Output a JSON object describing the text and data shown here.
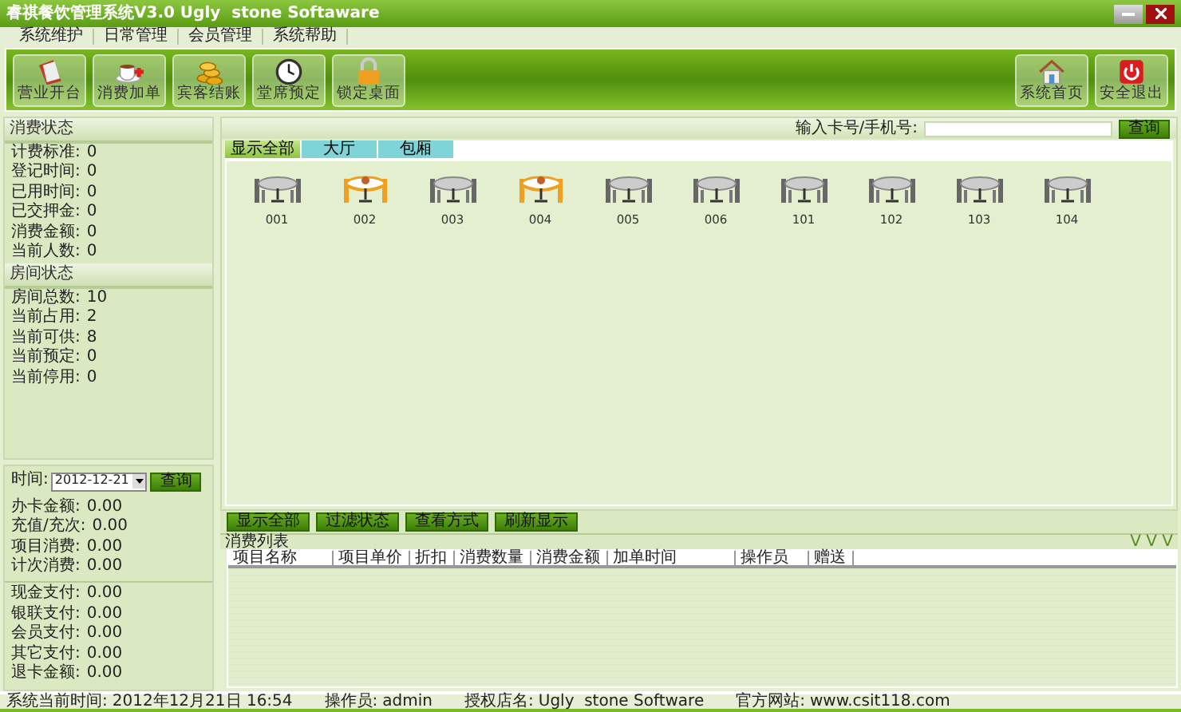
{
  "window": {
    "title": "睿祺餐饮管理系统V3.0 Ugly  stone Softaware"
  },
  "menu": [
    "系统维护",
    "日常管理",
    "会员管理",
    "系统帮助"
  ],
  "toolbar": [
    {
      "label": "营业开台",
      "kind": "book"
    },
    {
      "label": "消费加单",
      "kind": "cup"
    },
    {
      "label": "宾客结账",
      "kind": "coins"
    },
    {
      "label": "堂席预定",
      "kind": "clock"
    },
    {
      "label": "锁定桌面",
      "kind": "lock"
    }
  ],
  "toolbar_right": [
    {
      "label": "系统首页",
      "kind": "home"
    },
    {
      "label": "安全退出",
      "kind": "power"
    }
  ],
  "consumption_status": {
    "title": "消费状态",
    "rows": [
      {
        "label": "计费标准:",
        "value": "0"
      },
      {
        "label": "登记时间:",
        "value": "0"
      },
      {
        "label": "已用时间:",
        "value": "0"
      },
      {
        "label": "已交押金:",
        "value": "0"
      },
      {
        "label": "消费金额:",
        "value": "0"
      },
      {
        "label": "当前人数:",
        "value": "0"
      }
    ]
  },
  "room_status": {
    "title": "房间状态",
    "rows": [
      {
        "label": "房间总数:",
        "value": "10"
      },
      {
        "label": "当前占用:",
        "value": "2"
      },
      {
        "label": "当前可供:",
        "value": "8"
      },
      {
        "label": "当前预定:",
        "value": "0"
      },
      {
        "label": "当前停用:",
        "value": "0"
      }
    ]
  },
  "date_filter": {
    "label": "时间:",
    "value": "2012-12-21",
    "button": "查询"
  },
  "card_totals": [
    {
      "label": "办卡金额:",
      "value": "0.00"
    },
    {
      "label": "充值/充次:",
      "value": "0.00"
    },
    {
      "label": "项目消费:",
      "value": "0.00"
    },
    {
      "label": "计次消费:",
      "value": "0.00"
    }
  ],
  "payment_totals": [
    {
      "label": "现金支付:",
      "value": "0.00"
    },
    {
      "label": "银联支付:",
      "value": "0.00"
    },
    {
      "label": "会员支付:",
      "value": "0.00"
    },
    {
      "label": "其它支付:",
      "value": "0.00"
    },
    {
      "label": "退卡金额:",
      "value": "0.00"
    }
  ],
  "search": {
    "label": "输入卡号/手机号:",
    "button": "查询"
  },
  "tabs": [
    {
      "label": "显示全部",
      "selected": true
    },
    {
      "label": "大厅",
      "selected": false
    },
    {
      "label": "包厢",
      "selected": false
    }
  ],
  "tables": [
    {
      "number": "001",
      "occupied": false
    },
    {
      "number": "002",
      "occupied": true
    },
    {
      "number": "003",
      "occupied": false
    },
    {
      "number": "004",
      "occupied": true
    },
    {
      "number": "005",
      "occupied": false
    },
    {
      "number": "006",
      "occupied": false
    },
    {
      "number": "101",
      "occupied": false
    },
    {
      "number": "102",
      "occupied": false
    },
    {
      "number": "103",
      "occupied": false
    },
    {
      "number": "104",
      "occupied": false
    }
  ],
  "bottom_buttons": [
    "显示全部",
    "过滤状态",
    "查看方式",
    "刷新显示"
  ],
  "consumption_list": {
    "title": "消费列表",
    "collapse": "V V V",
    "columns": [
      "项目名称",
      "项目单价",
      "折扣",
      "消费数量",
      "消费金额",
      "加单时间",
      "操作员",
      "赠送"
    ]
  },
  "status_bar": [
    {
      "label": "系统当前时间:",
      "value": "2012年12月21日 16:54"
    },
    {
      "label": "操作员:",
      "value": "admin"
    },
    {
      "label": "授权店名:",
      "value": "Ugly  stone Software"
    },
    {
      "label": "官方网站:",
      "value": "www.csit118.com"
    }
  ]
}
